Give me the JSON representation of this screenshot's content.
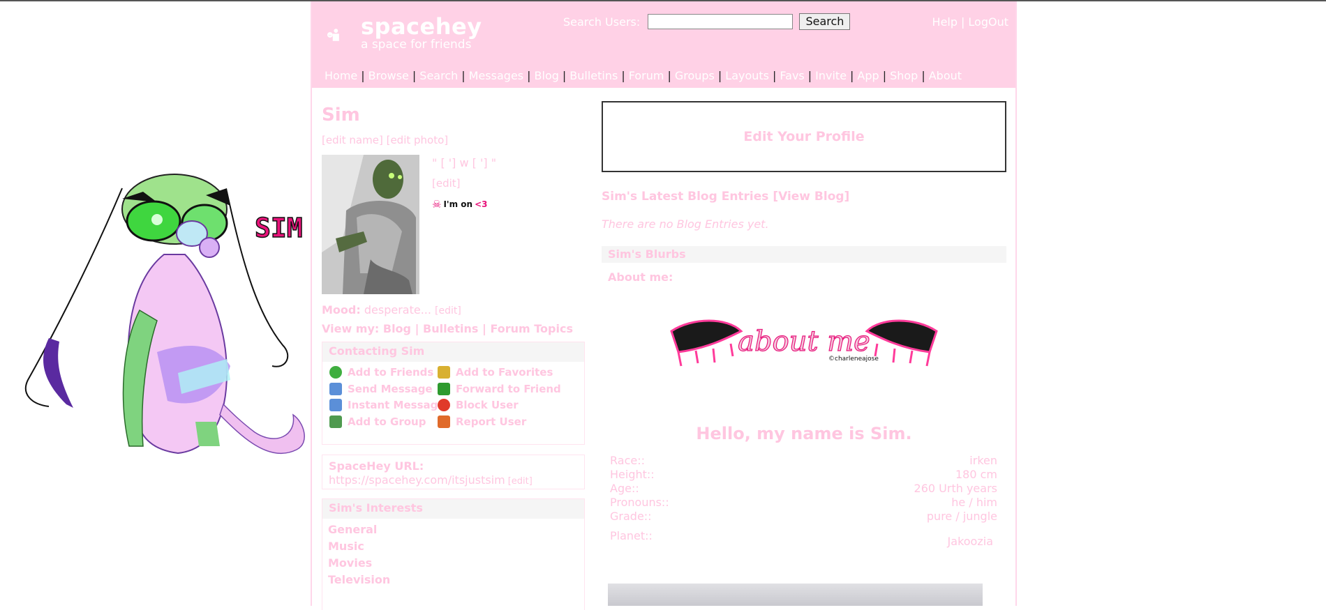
{
  "header": {
    "logo_title": "spacehey",
    "logo_subtitle": "a space for friends",
    "search_label": "Search Users:",
    "search_button": "Search",
    "help": "Help",
    "logout": "LogOut"
  },
  "nav": [
    "Home",
    "Browse",
    "Search",
    "Messages",
    "Blog",
    "Bulletins",
    "Forum",
    "Groups",
    "Layouts",
    "Favs",
    "Invite",
    "App",
    "Shop",
    "About"
  ],
  "mascot_label": "SIM",
  "profile": {
    "name": "Sim",
    "edit_name": "[edit name]",
    "edit_photo": "[edit photo]",
    "status": "\" [ '] w [ '] \"",
    "status_edit": "[edit]",
    "online_text": "I'm on",
    "online_heart": "<3",
    "mood_label": "Mood:",
    "mood_value": "desperate...",
    "mood_edit": "[edit]",
    "view_my_label": "View my:",
    "view_my_links": [
      "Blog",
      "Bulletins",
      "Forum Topics"
    ]
  },
  "contact": {
    "title": "Contacting Sim",
    "items": [
      {
        "label": "Add to Friends",
        "icon": "add-friend-icon",
        "color": "#3fae3f"
      },
      {
        "label": "Add to Favorites",
        "icon": "favorites-icon",
        "color": "#d8b030"
      },
      {
        "label": "Send Message",
        "icon": "message-icon",
        "color": "#5b8fd8"
      },
      {
        "label": "Forward to Friend",
        "icon": "forward-icon",
        "color": "#2e9a2e"
      },
      {
        "label": "Instant Message",
        "icon": "envelope-icon",
        "color": "#5b8fd8"
      },
      {
        "label": "Block User",
        "icon": "block-icon",
        "color": "#e03a2a"
      },
      {
        "label": "Add to Group",
        "icon": "group-icon",
        "color": "#4f9a4f"
      },
      {
        "label": "Report User",
        "icon": "report-icon",
        "color": "#e06a2a"
      }
    ]
  },
  "url_box": {
    "label": "SpaceHey URL:",
    "value": "https://spacehey.com/itsjustsim",
    "edit": "[edit]"
  },
  "interests": {
    "title": "Sim's Interests",
    "rows": [
      "General",
      "Music",
      "Movies",
      "Television"
    ]
  },
  "right": {
    "edit_profile": "Edit Your Profile",
    "blog_title": "Sim's Latest Blog Entries [View Blog]",
    "no_blog": "There are no Blog Entries yet.",
    "blurbs_title": "Sim's Blurbs",
    "about_me": "About me:",
    "banner_text": "about me",
    "banner_credit": "©charleneajose",
    "hello": "Hello, my name is Sim.",
    "facts": [
      {
        "key": "Race::",
        "value": "irken"
      },
      {
        "key": "Height::",
        "value": "180 cm"
      },
      {
        "key": "Age::",
        "value": "260 Urth years"
      },
      {
        "key": "Pronouns::",
        "value": "he / him"
      },
      {
        "key": "Grade::",
        "value": "pure / jungle"
      },
      {
        "key": "Planet::",
        "value": "Jakoozia"
      }
    ]
  },
  "colors": {
    "header_pink": "#ffd1e6",
    "text_pink": "#ffc6e0",
    "box_gray": "#f5f5f5"
  }
}
